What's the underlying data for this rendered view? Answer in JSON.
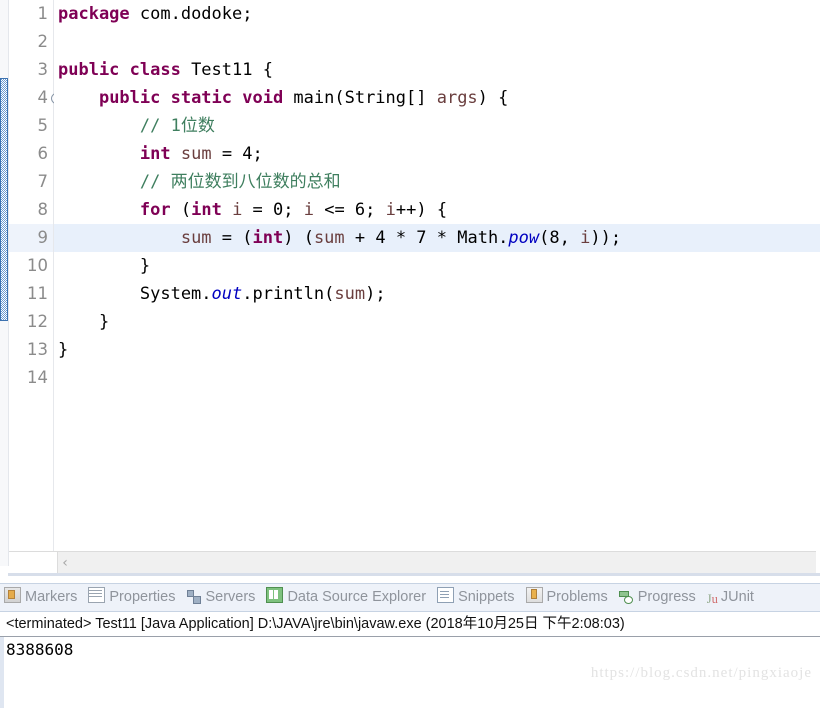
{
  "editor": {
    "lines": [
      {
        "num": "1",
        "fold": false,
        "highlight": false,
        "tokens": [
          {
            "t": "kw",
            "v": "package"
          },
          {
            "t": "pln",
            "v": " com.dodoke;"
          }
        ]
      },
      {
        "num": "2",
        "fold": false,
        "highlight": false,
        "tokens": []
      },
      {
        "num": "3",
        "fold": false,
        "highlight": false,
        "tokens": [
          {
            "t": "kw",
            "v": "public class"
          },
          {
            "t": "pln",
            "v": " Test11 {"
          }
        ]
      },
      {
        "num": "4",
        "fold": true,
        "highlight": false,
        "tokens": [
          {
            "t": "pln",
            "v": "    "
          },
          {
            "t": "kw",
            "v": "public static void"
          },
          {
            "t": "pln",
            "v": " main(String[] "
          },
          {
            "t": "prm",
            "v": "args"
          },
          {
            "t": "pln",
            "v": ") {"
          }
        ]
      },
      {
        "num": "5",
        "fold": false,
        "highlight": false,
        "tokens": [
          {
            "t": "pln",
            "v": "        "
          },
          {
            "t": "cmt",
            "v": "// 1位数"
          }
        ]
      },
      {
        "num": "6",
        "fold": false,
        "highlight": false,
        "tokens": [
          {
            "t": "pln",
            "v": "        "
          },
          {
            "t": "kw",
            "v": "int"
          },
          {
            "t": "pln",
            "v": " "
          },
          {
            "t": "prm",
            "v": "sum"
          },
          {
            "t": "pln",
            "v": " = 4;"
          }
        ]
      },
      {
        "num": "7",
        "fold": false,
        "highlight": false,
        "tokens": [
          {
            "t": "pln",
            "v": "        "
          },
          {
            "t": "cmt",
            "v": "// 两位数到八位数的总和"
          }
        ]
      },
      {
        "num": "8",
        "fold": false,
        "highlight": false,
        "tokens": [
          {
            "t": "pln",
            "v": "        "
          },
          {
            "t": "kw",
            "v": "for"
          },
          {
            "t": "pln",
            "v": " ("
          },
          {
            "t": "kw",
            "v": "int"
          },
          {
            "t": "pln",
            "v": " "
          },
          {
            "t": "prm",
            "v": "i"
          },
          {
            "t": "pln",
            "v": " = 0; "
          },
          {
            "t": "prm",
            "v": "i"
          },
          {
            "t": "pln",
            "v": " <= 6; "
          },
          {
            "t": "prm",
            "v": "i"
          },
          {
            "t": "pln",
            "v": "++) {"
          }
        ]
      },
      {
        "num": "9",
        "fold": false,
        "highlight": true,
        "tokens": [
          {
            "t": "pln",
            "v": "            "
          },
          {
            "t": "prm",
            "v": "sum"
          },
          {
            "t": "pln",
            "v": " = ("
          },
          {
            "t": "kw",
            "v": "int"
          },
          {
            "t": "pln",
            "v": ") ("
          },
          {
            "t": "prm",
            "v": "sum"
          },
          {
            "t": "pln",
            "v": " + 4 * 7 * Math."
          },
          {
            "t": "fld",
            "v": "pow"
          },
          {
            "t": "pln",
            "v": "(8, "
          },
          {
            "t": "prm",
            "v": "i"
          },
          {
            "t": "pln",
            "v": "));"
          }
        ]
      },
      {
        "num": "10",
        "fold": false,
        "highlight": false,
        "tokens": [
          {
            "t": "pln",
            "v": "        }"
          }
        ]
      },
      {
        "num": "11",
        "fold": false,
        "highlight": false,
        "tokens": [
          {
            "t": "pln",
            "v": "        System."
          },
          {
            "t": "fld",
            "v": "out"
          },
          {
            "t": "pln",
            "v": ".println("
          },
          {
            "t": "prm",
            "v": "sum"
          },
          {
            "t": "pln",
            "v": ");"
          }
        ]
      },
      {
        "num": "12",
        "fold": false,
        "highlight": false,
        "tokens": [
          {
            "t": "pln",
            "v": "    }"
          }
        ]
      },
      {
        "num": "13",
        "fold": false,
        "highlight": false,
        "tokens": [
          {
            "t": "pln",
            "v": "}"
          }
        ]
      },
      {
        "num": "14",
        "fold": false,
        "highlight": false,
        "tokens": []
      }
    ],
    "scroll_left_arrow": "‹"
  },
  "bottom_panel": {
    "tabs": [
      {
        "label": "Markers",
        "icon": "markers-icon",
        "icon_class": "ic-markers"
      },
      {
        "label": "Properties",
        "icon": "properties-icon",
        "icon_class": "ic-properties"
      },
      {
        "label": "Servers",
        "icon": "servers-icon",
        "icon_class": "ic-servers"
      },
      {
        "label": "Data Source Explorer",
        "icon": "datasource-icon",
        "icon_class": "ic-datasource"
      },
      {
        "label": "Snippets",
        "icon": "snippets-icon",
        "icon_class": "ic-snippets"
      },
      {
        "label": "Problems",
        "icon": "problems-icon",
        "icon_class": "ic-problems"
      },
      {
        "label": "Progress",
        "icon": "progress-icon",
        "icon_class": "ic-progress"
      },
      {
        "label": "JUnit",
        "icon": "junit-icon",
        "icon_class": "ic-junit"
      }
    ],
    "console": {
      "header": "<terminated> Test11 [Java Application] D:\\JAVA\\jre\\bin\\javaw.exe (2018年10月25日 下午2:08:03)",
      "output": "8388608"
    }
  },
  "watermark": {
    "text": "https://blog.csdn.net/pingxiaoje"
  },
  "colors": {
    "keyword": "#7f0055",
    "comment": "#3f7f5f",
    "field": "#0000c0",
    "parameter": "#6a3e3e",
    "line_highlight": "#e8f0fb",
    "annotation_bar": "#6b9bd2",
    "tab_bar_bg": "#eef2f9"
  }
}
